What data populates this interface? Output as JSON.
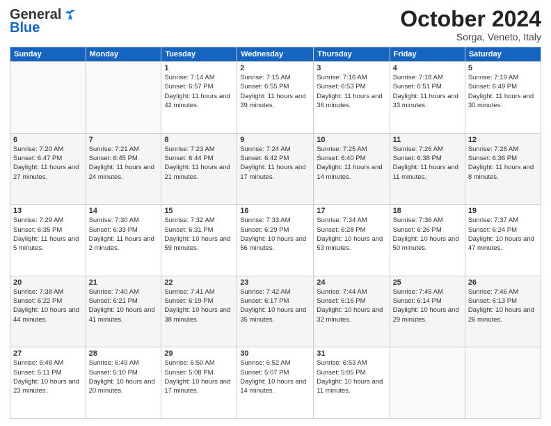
{
  "header": {
    "logo_general": "General",
    "logo_blue": "Blue",
    "month": "October 2024",
    "location": "Sorga, Veneto, Italy"
  },
  "days_of_week": [
    "Sunday",
    "Monday",
    "Tuesday",
    "Wednesday",
    "Thursday",
    "Friday",
    "Saturday"
  ],
  "weeks": [
    [
      {
        "day": "",
        "info": ""
      },
      {
        "day": "",
        "info": ""
      },
      {
        "day": "1",
        "info": "Sunrise: 7:14 AM\nSunset: 6:57 PM\nDaylight: 11 hours and 42 minutes."
      },
      {
        "day": "2",
        "info": "Sunrise: 7:15 AM\nSunset: 6:55 PM\nDaylight: 11 hours and 39 minutes."
      },
      {
        "day": "3",
        "info": "Sunrise: 7:16 AM\nSunset: 6:53 PM\nDaylight: 11 hours and 36 minutes."
      },
      {
        "day": "4",
        "info": "Sunrise: 7:18 AM\nSunset: 6:51 PM\nDaylight: 11 hours and 33 minutes."
      },
      {
        "day": "5",
        "info": "Sunrise: 7:19 AM\nSunset: 6:49 PM\nDaylight: 11 hours and 30 minutes."
      }
    ],
    [
      {
        "day": "6",
        "info": "Sunrise: 7:20 AM\nSunset: 6:47 PM\nDaylight: 11 hours and 27 minutes."
      },
      {
        "day": "7",
        "info": "Sunrise: 7:21 AM\nSunset: 6:45 PM\nDaylight: 11 hours and 24 minutes."
      },
      {
        "day": "8",
        "info": "Sunrise: 7:23 AM\nSunset: 6:44 PM\nDaylight: 11 hours and 21 minutes."
      },
      {
        "day": "9",
        "info": "Sunrise: 7:24 AM\nSunset: 6:42 PM\nDaylight: 11 hours and 17 minutes."
      },
      {
        "day": "10",
        "info": "Sunrise: 7:25 AM\nSunset: 6:40 PM\nDaylight: 11 hours and 14 minutes."
      },
      {
        "day": "11",
        "info": "Sunrise: 7:26 AM\nSunset: 6:38 PM\nDaylight: 11 hours and 11 minutes."
      },
      {
        "day": "12",
        "info": "Sunrise: 7:28 AM\nSunset: 6:36 PM\nDaylight: 11 hours and 8 minutes."
      }
    ],
    [
      {
        "day": "13",
        "info": "Sunrise: 7:29 AM\nSunset: 6:35 PM\nDaylight: 11 hours and 5 minutes."
      },
      {
        "day": "14",
        "info": "Sunrise: 7:30 AM\nSunset: 6:33 PM\nDaylight: 11 hours and 2 minutes."
      },
      {
        "day": "15",
        "info": "Sunrise: 7:32 AM\nSunset: 6:31 PM\nDaylight: 10 hours and 59 minutes."
      },
      {
        "day": "16",
        "info": "Sunrise: 7:33 AM\nSunset: 6:29 PM\nDaylight: 10 hours and 56 minutes."
      },
      {
        "day": "17",
        "info": "Sunrise: 7:34 AM\nSunset: 6:28 PM\nDaylight: 10 hours and 53 minutes."
      },
      {
        "day": "18",
        "info": "Sunrise: 7:36 AM\nSunset: 6:26 PM\nDaylight: 10 hours and 50 minutes."
      },
      {
        "day": "19",
        "info": "Sunrise: 7:37 AM\nSunset: 6:24 PM\nDaylight: 10 hours and 47 minutes."
      }
    ],
    [
      {
        "day": "20",
        "info": "Sunrise: 7:38 AM\nSunset: 6:22 PM\nDaylight: 10 hours and 44 minutes."
      },
      {
        "day": "21",
        "info": "Sunrise: 7:40 AM\nSunset: 6:21 PM\nDaylight: 10 hours and 41 minutes."
      },
      {
        "day": "22",
        "info": "Sunrise: 7:41 AM\nSunset: 6:19 PM\nDaylight: 10 hours and 38 minutes."
      },
      {
        "day": "23",
        "info": "Sunrise: 7:42 AM\nSunset: 6:17 PM\nDaylight: 10 hours and 35 minutes."
      },
      {
        "day": "24",
        "info": "Sunrise: 7:44 AM\nSunset: 6:16 PM\nDaylight: 10 hours and 32 minutes."
      },
      {
        "day": "25",
        "info": "Sunrise: 7:45 AM\nSunset: 6:14 PM\nDaylight: 10 hours and 29 minutes."
      },
      {
        "day": "26",
        "info": "Sunrise: 7:46 AM\nSunset: 6:13 PM\nDaylight: 10 hours and 26 minutes."
      }
    ],
    [
      {
        "day": "27",
        "info": "Sunrise: 6:48 AM\nSunset: 5:11 PM\nDaylight: 10 hours and 23 minutes."
      },
      {
        "day": "28",
        "info": "Sunrise: 6:49 AM\nSunset: 5:10 PM\nDaylight: 10 hours and 20 minutes."
      },
      {
        "day": "29",
        "info": "Sunrise: 6:50 AM\nSunset: 5:08 PM\nDaylight: 10 hours and 17 minutes."
      },
      {
        "day": "30",
        "info": "Sunrise: 6:52 AM\nSunset: 5:07 PM\nDaylight: 10 hours and 14 minutes."
      },
      {
        "day": "31",
        "info": "Sunrise: 6:53 AM\nSunset: 5:05 PM\nDaylight: 10 hours and 11 minutes."
      },
      {
        "day": "",
        "info": ""
      },
      {
        "day": "",
        "info": ""
      }
    ]
  ]
}
